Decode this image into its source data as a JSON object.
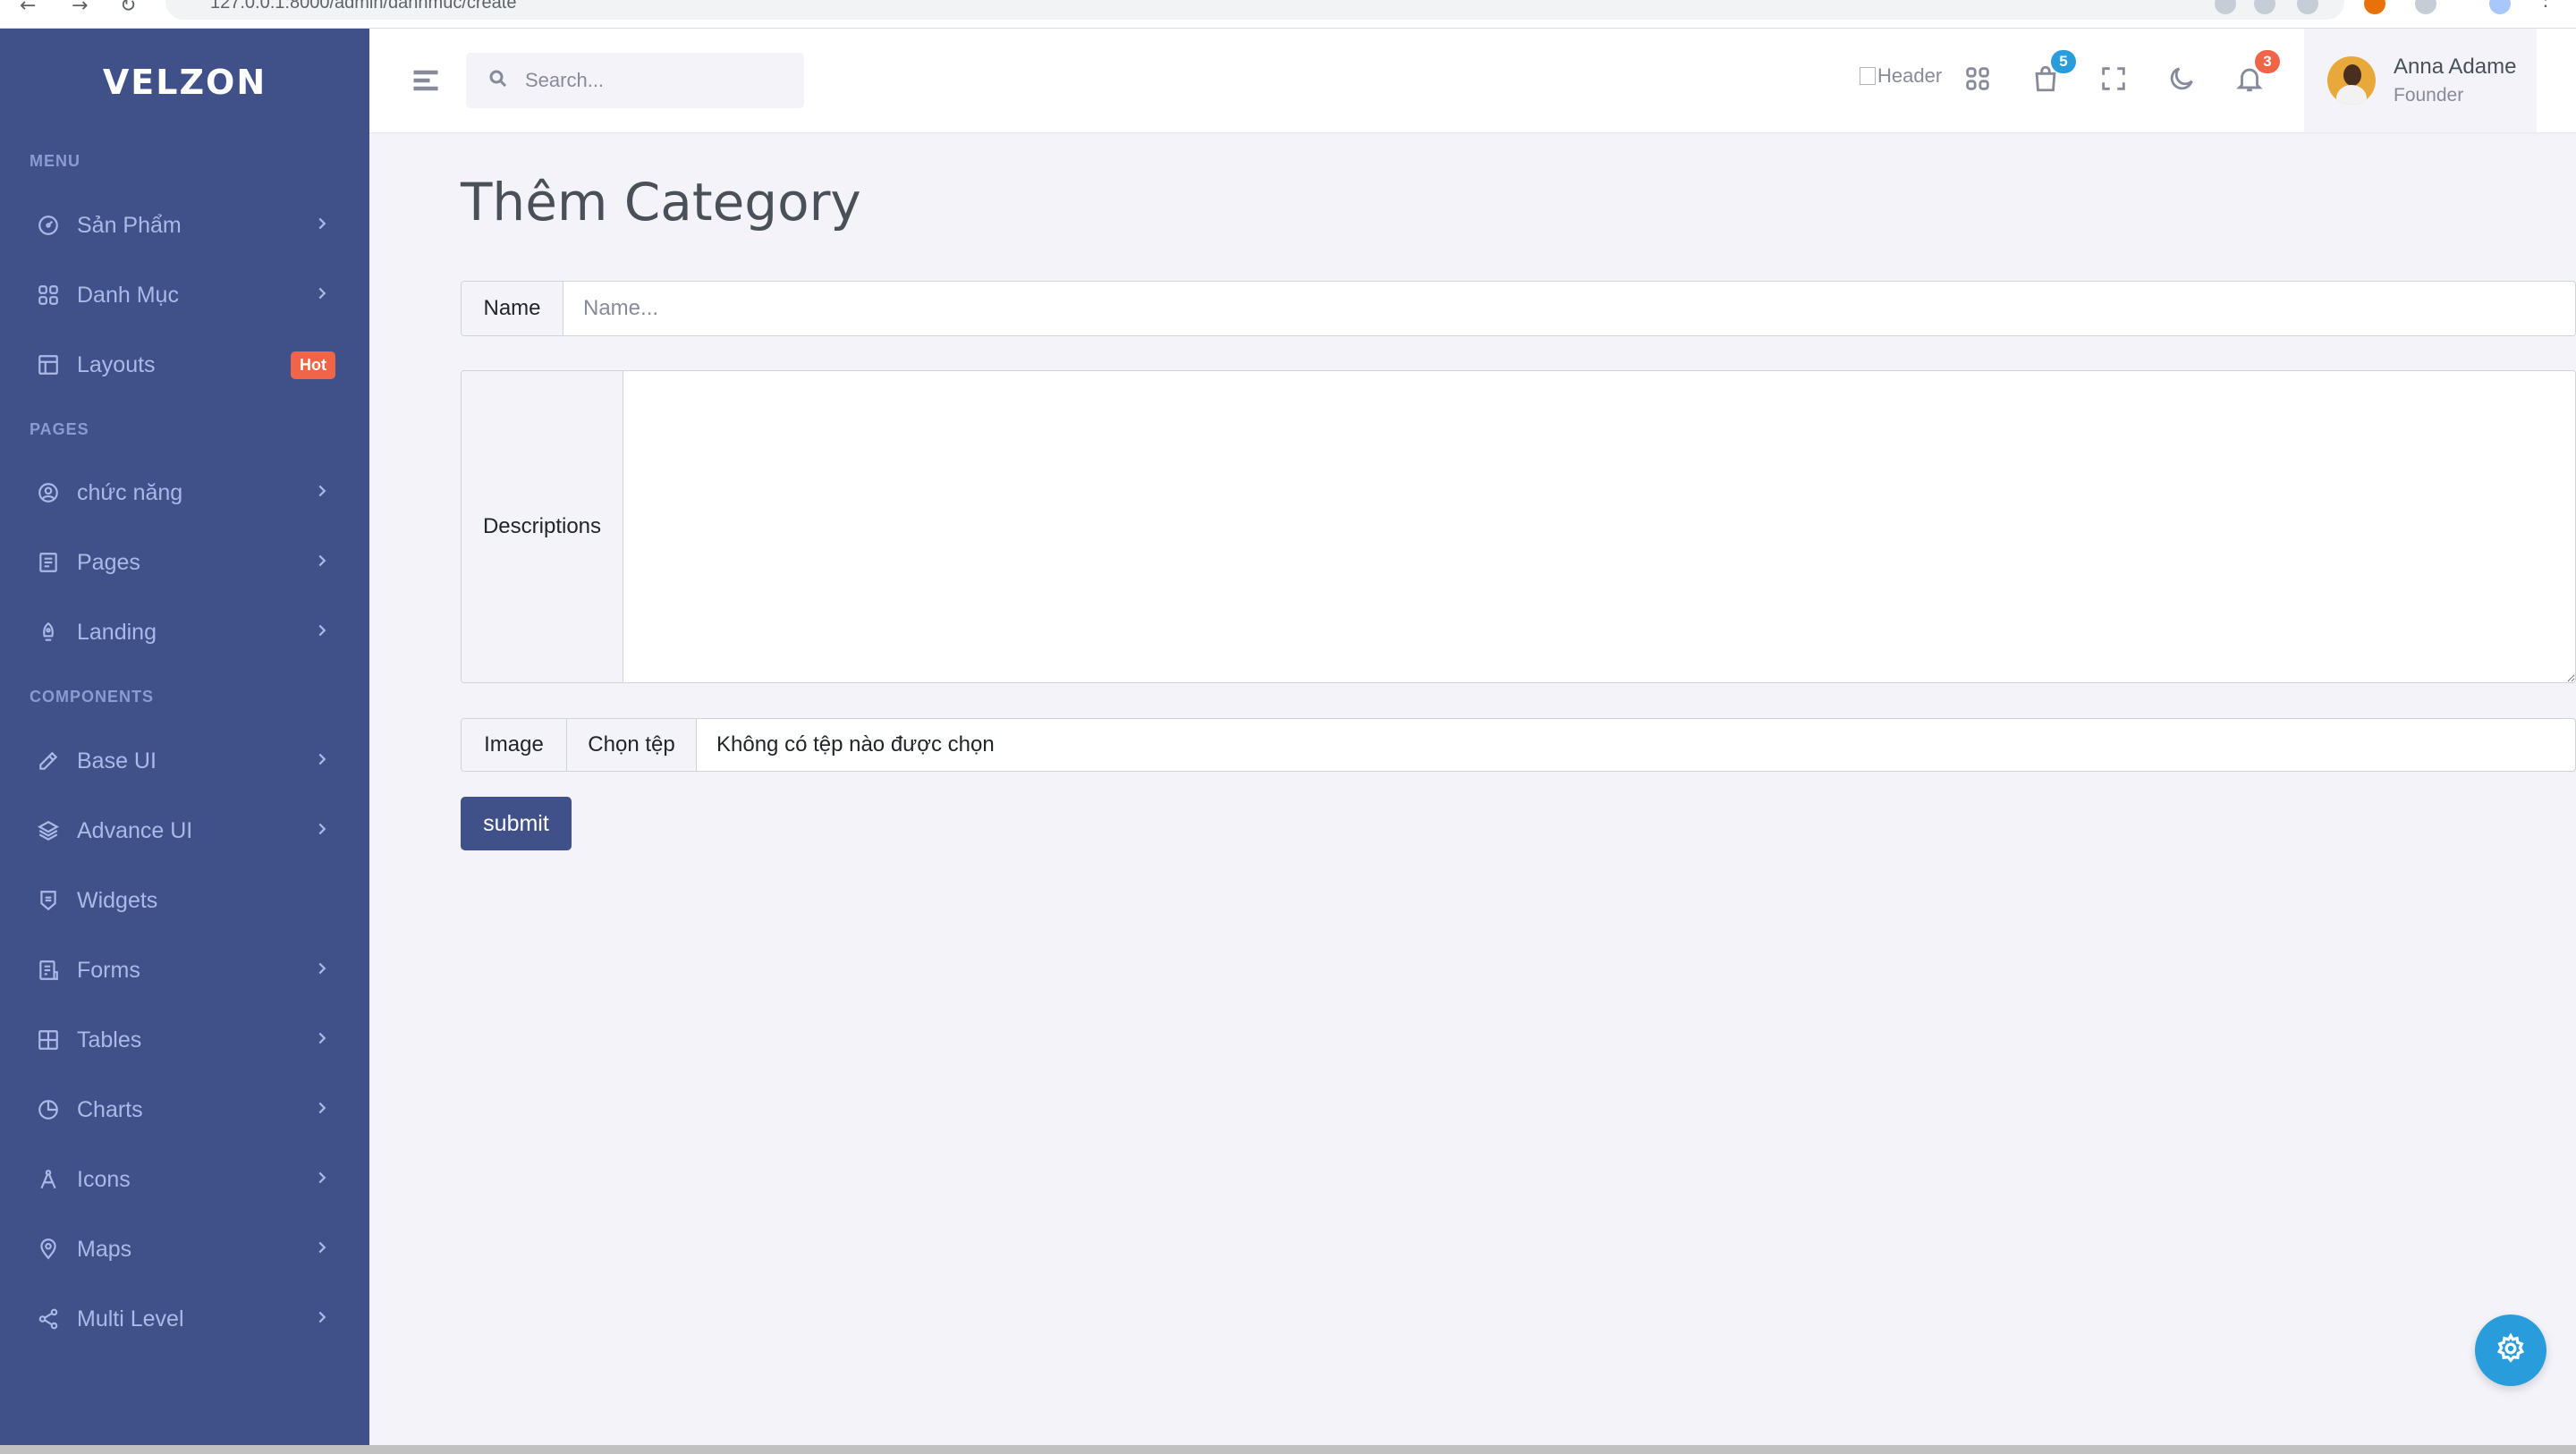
{
  "browser": {
    "url": "127.0.0.1:8000/admin/danhmuc/create"
  },
  "app": {
    "logo_text": "VELZON"
  },
  "sidebar": {
    "sections": {
      "menu": "MENU",
      "pages": "PAGES",
      "components": "COMPONENTS"
    },
    "items": [
      {
        "label": "Sản Phẩm",
        "icon": "dashboard-icon",
        "chevron": true
      },
      {
        "label": "Danh Mục",
        "icon": "apps-icon",
        "chevron": true
      },
      {
        "label": "Layouts",
        "icon": "layout-icon",
        "badge": "Hot"
      },
      {
        "label": "chức năng",
        "icon": "account-circle-icon",
        "chevron": true
      },
      {
        "label": "Pages",
        "icon": "pages-icon",
        "chevron": true
      },
      {
        "label": "Landing",
        "icon": "rocket-icon",
        "chevron": true
      },
      {
        "label": "Base UI",
        "icon": "pencil-ruler-icon",
        "chevron": true
      },
      {
        "label": "Advance UI",
        "icon": "stack-icon",
        "chevron": true
      },
      {
        "label": "Widgets",
        "icon": "honour-icon",
        "chevron": false
      },
      {
        "label": "Forms",
        "icon": "file-list-icon",
        "chevron": true
      },
      {
        "label": "Tables",
        "icon": "table-icon",
        "chevron": true
      },
      {
        "label": "Charts",
        "icon": "pie-chart-icon",
        "chevron": true
      },
      {
        "label": "Icons",
        "icon": "compasses-icon",
        "chevron": true
      },
      {
        "label": "Maps",
        "icon": "map-pin-icon",
        "chevron": true
      },
      {
        "label": "Multi Level",
        "icon": "share-icon",
        "chevron": true
      }
    ]
  },
  "header": {
    "search_placeholder": "Search...",
    "broken_image_alt": "Header",
    "cart_count": "5",
    "notification_count": "3",
    "user_name": "Anna Adame",
    "user_role": "Founder"
  },
  "form": {
    "title": "Thêm Category",
    "name_label": "Name",
    "name_placeholder": "Name...",
    "descriptions_label": "Descriptions",
    "image_label": "Image",
    "choose_file": "Chọn tệp",
    "no_file": "Không có tệp nào được chọn",
    "submit": "submit"
  },
  "colors": {
    "sidebar_bg": "#405189",
    "accent_blue": "#299cdb",
    "danger": "#f06548",
    "primary_button": "#405189"
  }
}
